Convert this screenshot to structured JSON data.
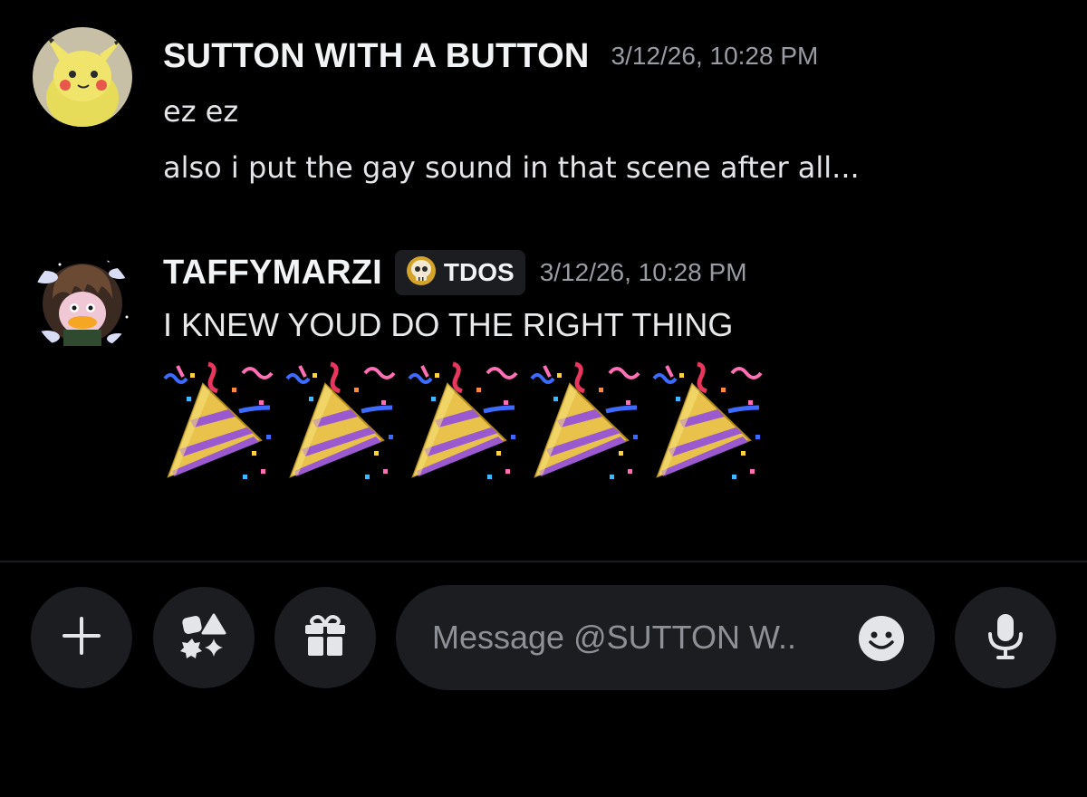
{
  "messages": [
    {
      "username": "SUTTON WITH A BUTTON",
      "timestamp": "3/12/26, 10:28 PM",
      "avatar_icon": "pikachu-avatar",
      "lines": [
        "ez ez",
        "also i put the gay sound in that scene after all..."
      ]
    },
    {
      "username": "TAFFYMARZI",
      "tag": {
        "icon": "skull-icon",
        "label": "TDOS"
      },
      "timestamp": "3/12/26, 10:28 PM",
      "avatar_icon": "penguin-avatar-with-clouds",
      "lines": [
        "I KNEW YOUD DO THE RIGHT THING"
      ],
      "emoji": [
        "party-popper",
        "party-popper",
        "party-popper",
        "party-popper",
        "party-popper"
      ]
    }
  ],
  "composer": {
    "placeholder": "Message @SUTTON W..",
    "buttons": [
      "plus-icon",
      "apps-icon",
      "gift-icon",
      "emoji-icon",
      "microphone-icon"
    ]
  },
  "colors": {
    "background": "#000000",
    "surface": "#1c1d21",
    "username": "#f2f3f5",
    "timestamp": "#9a9ca3"
  }
}
